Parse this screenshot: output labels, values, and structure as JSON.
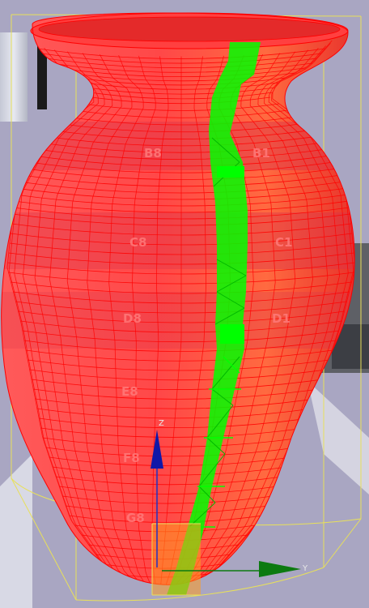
{
  "viewport": {
    "background": "#a9a6c2",
    "object": "vase",
    "object_color": "#ff3c3c",
    "wire_color": "#ff0000",
    "selection_color": "#00ff00",
    "bbox_color": "#e8e05a"
  },
  "uv_band_labels": [
    {
      "id": "b8",
      "text": "B8"
    },
    {
      "id": "b1",
      "text": "B1"
    },
    {
      "id": "c8",
      "text": "C8"
    },
    {
      "id": "c1",
      "text": "C1"
    },
    {
      "id": "d8",
      "text": "D8"
    },
    {
      "id": "d1",
      "text": "D1"
    },
    {
      "id": "e8",
      "text": "E8"
    },
    {
      "id": "f8",
      "text": "F8"
    },
    {
      "id": "g8",
      "text": "G8"
    }
  ],
  "gizmo": {
    "z_label": "Z",
    "y_label": "Y",
    "z_color": "#1018a8",
    "y_color": "#0c7a10"
  }
}
